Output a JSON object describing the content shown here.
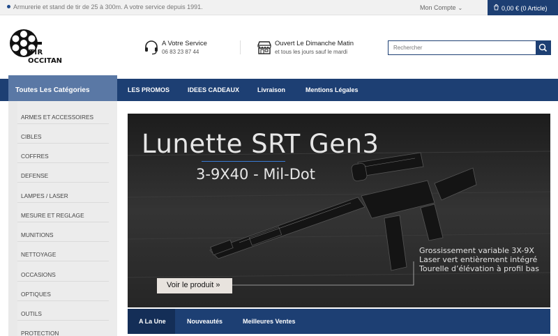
{
  "topbar": {
    "tagline": "Armurerie et stand de tir de 25 à 300m. A votre service depuis 1991.",
    "account_label": "Mon Compte",
    "cart_label": "0,00 € (0 Article)"
  },
  "header": {
    "logo_line1": "TIR",
    "logo_line2": "OCCITAN",
    "service_title": "A Votre Service",
    "service_phone": "06 83 23 87 44",
    "hours_title": "Ouvert Le Dimanche Matin",
    "hours_sub": "et tous les jours sauf le mardi",
    "search_placeholder": "Rechercher"
  },
  "nav": {
    "categories_label": "Toutes Les Catégories",
    "links": [
      "LES PROMOS",
      "IDEES CADEAUX",
      "Livraison",
      "Mentions Légales"
    ]
  },
  "sidebar": {
    "items": [
      "ARMES ET ACCESSOIRES",
      "CIBLES",
      "COFFRES",
      "DEFENSE",
      "LAMPES / LASER",
      "MESURE ET REGLAGE",
      "MUNITIONS",
      "NETTOYAGE",
      "OCCASIONS",
      "OPTIQUES",
      "OUTILS",
      "PROTECTION"
    ]
  },
  "banner": {
    "title": "Lunette SRT Gen3",
    "subtitle": "3-9X40 - Mil-Dot",
    "features": [
      "Grossissement variable 3X-9X",
      "Laser vert entièrement intégré",
      "Tourelle d’élévation à profil bas"
    ],
    "cta": "Voir le produit »"
  },
  "tabs": [
    "A La Une",
    "Nouveautés",
    "Meilleures Ventes"
  ],
  "colors": {
    "primary": "#1d3f73",
    "category_button": "#5a78a5",
    "sidebar_bg": "#ececec"
  },
  "icons": [
    "headset-icon",
    "store-icon",
    "search-icon",
    "cart-icon",
    "chevron-down-icon"
  ]
}
